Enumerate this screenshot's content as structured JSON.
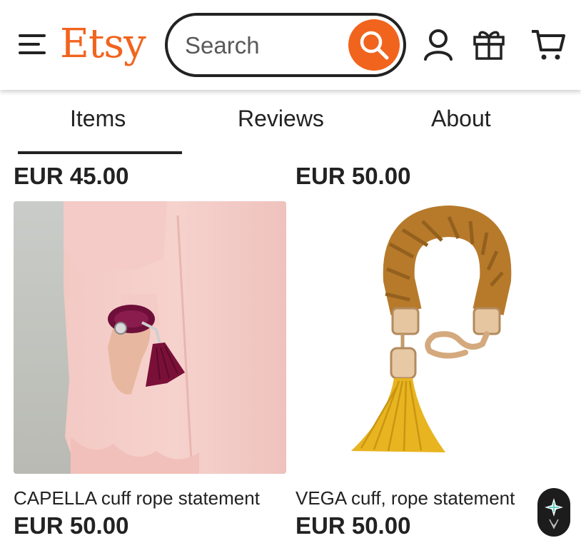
{
  "header": {
    "logo": "Etsy",
    "search_placeholder": "Search",
    "menu_icon": "hamburger-menu-icon",
    "search_icon": "search-icon",
    "account_icon": "user-icon",
    "gift_icon": "gift-icon",
    "cart_icon": "cart-icon"
  },
  "tabs": [
    {
      "label": "Items",
      "active": true
    },
    {
      "label": "Reviews",
      "active": false
    },
    {
      "label": "About",
      "active": false
    }
  ],
  "listings_above": [
    {
      "price": "EUR 45.00"
    },
    {
      "price": "EUR 50.00"
    }
  ],
  "listings": [
    {
      "title": "CAPELLA cuff rope statement",
      "price": "EUR 50.00"
    },
    {
      "title": "VEGA cuff, rope statement",
      "price": "EUR 50.00"
    }
  ],
  "colors": {
    "brand": "#f1641e",
    "text": "#222222"
  }
}
